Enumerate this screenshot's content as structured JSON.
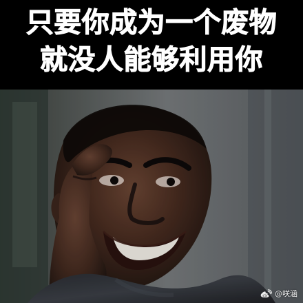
{
  "caption": {
    "line1": "只要你成为一个废物",
    "line2": "就没人能够利用你"
  },
  "watermark": {
    "logo_icon": "weibo-logo-icon",
    "handle": "@咲涵"
  },
  "colors": {
    "caption_background": "#000000",
    "caption_text": "#ffffff",
    "wall": "#5f6365",
    "shirt": "#2c2f35",
    "skin_dark": "#2a1a13",
    "skin_mid": "#5a3a2a",
    "teeth": "#f2efe7"
  }
}
